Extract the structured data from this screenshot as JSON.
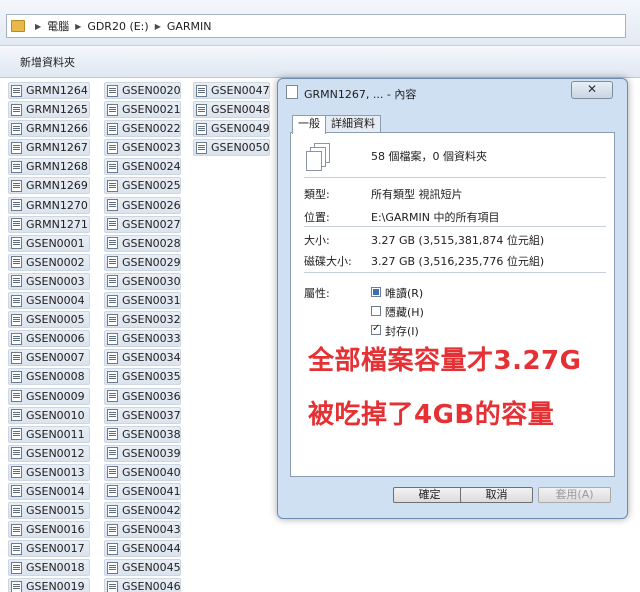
{
  "breadcrumb": [
    "電腦",
    "GDR20 (E:)",
    "GARMIN"
  ],
  "toolbar": {
    "new_folder": "新增資料夾"
  },
  "columns": [
    [
      "GRMN1264",
      "GRMN1265",
      "GRMN1266",
      "GRMN1267",
      "GRMN1268",
      "GRMN1269",
      "GRMN1270",
      "GRMN1271",
      "GSEN0001",
      "GSEN0002",
      "GSEN0003",
      "GSEN0004",
      "GSEN0005",
      "GSEN0006",
      "GSEN0007",
      "GSEN0008",
      "GSEN0009",
      "GSEN0010",
      "GSEN0011",
      "GSEN0012",
      "GSEN0013",
      "GSEN0014",
      "GSEN0015",
      "GSEN0016",
      "GSEN0017",
      "GSEN0018",
      "GSEN0019"
    ],
    [
      "GSEN0020",
      "GSEN0021",
      "GSEN0022",
      "GSEN0023",
      "GSEN0024",
      "GSEN0025",
      "GSEN0026",
      "GSEN0027",
      "GSEN0028",
      "GSEN0029",
      "GSEN0030",
      "GSEN0031",
      "GSEN0032",
      "GSEN0033",
      "GSEN0034",
      "GSEN0035",
      "GSEN0036",
      "GSEN0037",
      "GSEN0038",
      "GSEN0039",
      "GSEN0040",
      "GSEN0041",
      "GSEN0042",
      "GSEN0043",
      "GSEN0044",
      "GSEN0045",
      "GSEN0046"
    ],
    [
      "GSEN0047",
      "GSEN0048",
      "GSEN0049",
      "GSEN0050"
    ]
  ],
  "dialog": {
    "title": "GRMN1267, ... - 內容",
    "close": "✕",
    "tabs": [
      "一般",
      "詳細資料"
    ],
    "summary": "58 個檔案，0 個資料夾",
    "props": [
      {
        "label": "類型:",
        "value": "所有類型 視訊短片"
      },
      {
        "label": "位置:",
        "value": "E:\\GARMIN 中的所有項目"
      },
      {
        "label": "大小:",
        "value": "3.27 GB (3,515,381,874 位元組)"
      },
      {
        "label": "磁碟大小:",
        "value": "3.27 GB (3,516,235,776 位元組)"
      }
    ],
    "attributes_label": "屬性:",
    "attributes": [
      {
        "label": "唯讀(R)",
        "state": "mixed"
      },
      {
        "label": "隱藏(H)",
        "state": "unchecked"
      },
      {
        "label": "封存(I)",
        "state": "checked"
      }
    ],
    "buttons": {
      "ok": "確定",
      "cancel": "取消",
      "apply": "套用(A)"
    }
  },
  "annotation": {
    "line1": "全部檔案容量才3.27G",
    "line2": "被吃掉了4GB的容量",
    "color": "#e53034"
  }
}
